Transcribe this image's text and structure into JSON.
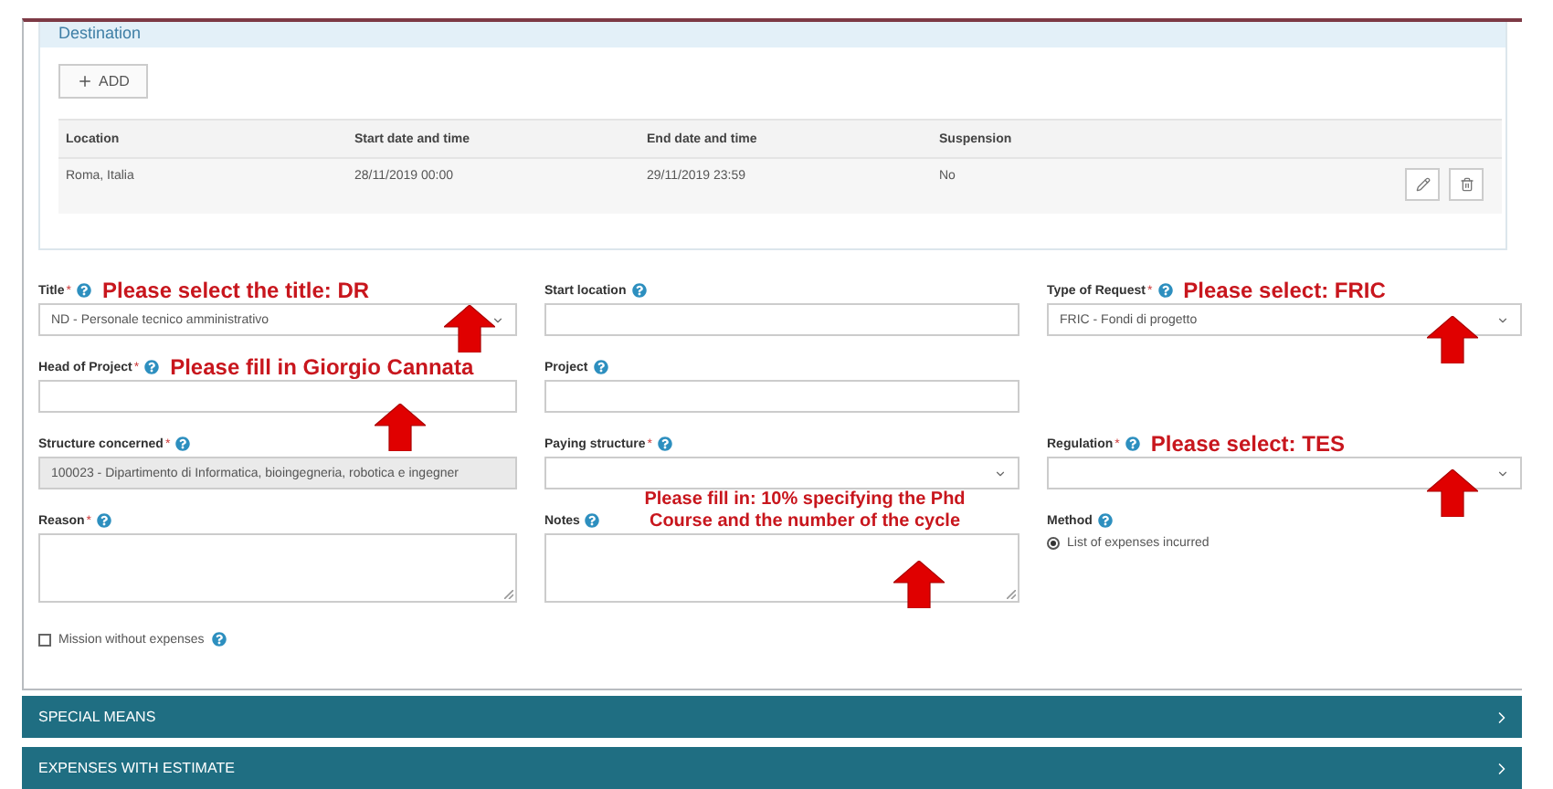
{
  "destination": {
    "title": "Destination",
    "add_button": {
      "label": "ADD"
    },
    "columns": [
      "Location",
      "Start date and time",
      "End date and time",
      "Suspension"
    ],
    "rows": [
      {
        "cells": [
          "Roma, Italia",
          "28/11/2019 00:00",
          "29/11/2019 23:59",
          "No"
        ]
      }
    ]
  },
  "form": {
    "rows": [
      [
        {
          "kind": "select",
          "label": "Title",
          "mark": "*",
          "help": true,
          "value": "ND - Personale tecnico amministrativo",
          "disabled": false,
          "annotation": "Please select the title: DR",
          "arrow": true
        },
        {
          "kind": "input",
          "label": "Start location",
          "help": true,
          "disabled": false,
          "arrow": false
        },
        {
          "kind": "select",
          "label": "Type of Request",
          "mark": "*",
          "help": true,
          "value": "FRIC - Fondi di progetto",
          "disabled": false,
          "annotation": "Please select: FRIC",
          "arrow": true
        }
      ],
      [
        {
          "kind": "input",
          "label": "Head of Project",
          "mark": "*",
          "help": true,
          "disabled": false,
          "annotation": "Please fill in Giorgio  Cannata",
          "arrow": true
        },
        {
          "kind": "input",
          "label": "Project",
          "help": true,
          "disabled": false,
          "arrow": false
        }
      ],
      [
        {
          "kind": "input",
          "label": "Structure concerned",
          "mark": "*",
          "help": true,
          "value": "100023 - Dipartimento di Informatica, bioingegneria, robotica e ingegner",
          "disabled": true,
          "arrow": false
        },
        {
          "kind": "select",
          "label": "Paying structure",
          "mark": "*",
          "help": true,
          "disabled": false,
          "arrow": false
        },
        {
          "kind": "select",
          "label": "Regulation",
          "mark": "*",
          "help": true,
          "disabled": false,
          "annotation": "Please select: TES",
          "arrow": true
        }
      ],
      [
        {
          "kind": "textarea",
          "label": "Reason",
          "mark": "*",
          "help": true,
          "disabled": false,
          "arrow": false
        },
        {
          "kind": "textarea",
          "label": "Notes",
          "help": true,
          "disabled": false,
          "annotation": "Please fill in: 10% specifying the Phd Course and the number of the cycle",
          "arrow": true
        },
        {
          "kind": "radio",
          "label": "Method",
          "help": true,
          "arrow": false,
          "options": [
            {
              "label": "List of expenses incurred",
              "selected": true
            }
          ]
        }
      ]
    ],
    "checkbox": {
      "label": "Mission without expenses",
      "checked": false,
      "help": true
    }
  },
  "sections": [
    {
      "label": "SPECIAL MEANS",
      "expanded": false
    },
    {
      "label": "EXPENSES WITH ESTIMATE",
      "expanded": false
    }
  ]
}
